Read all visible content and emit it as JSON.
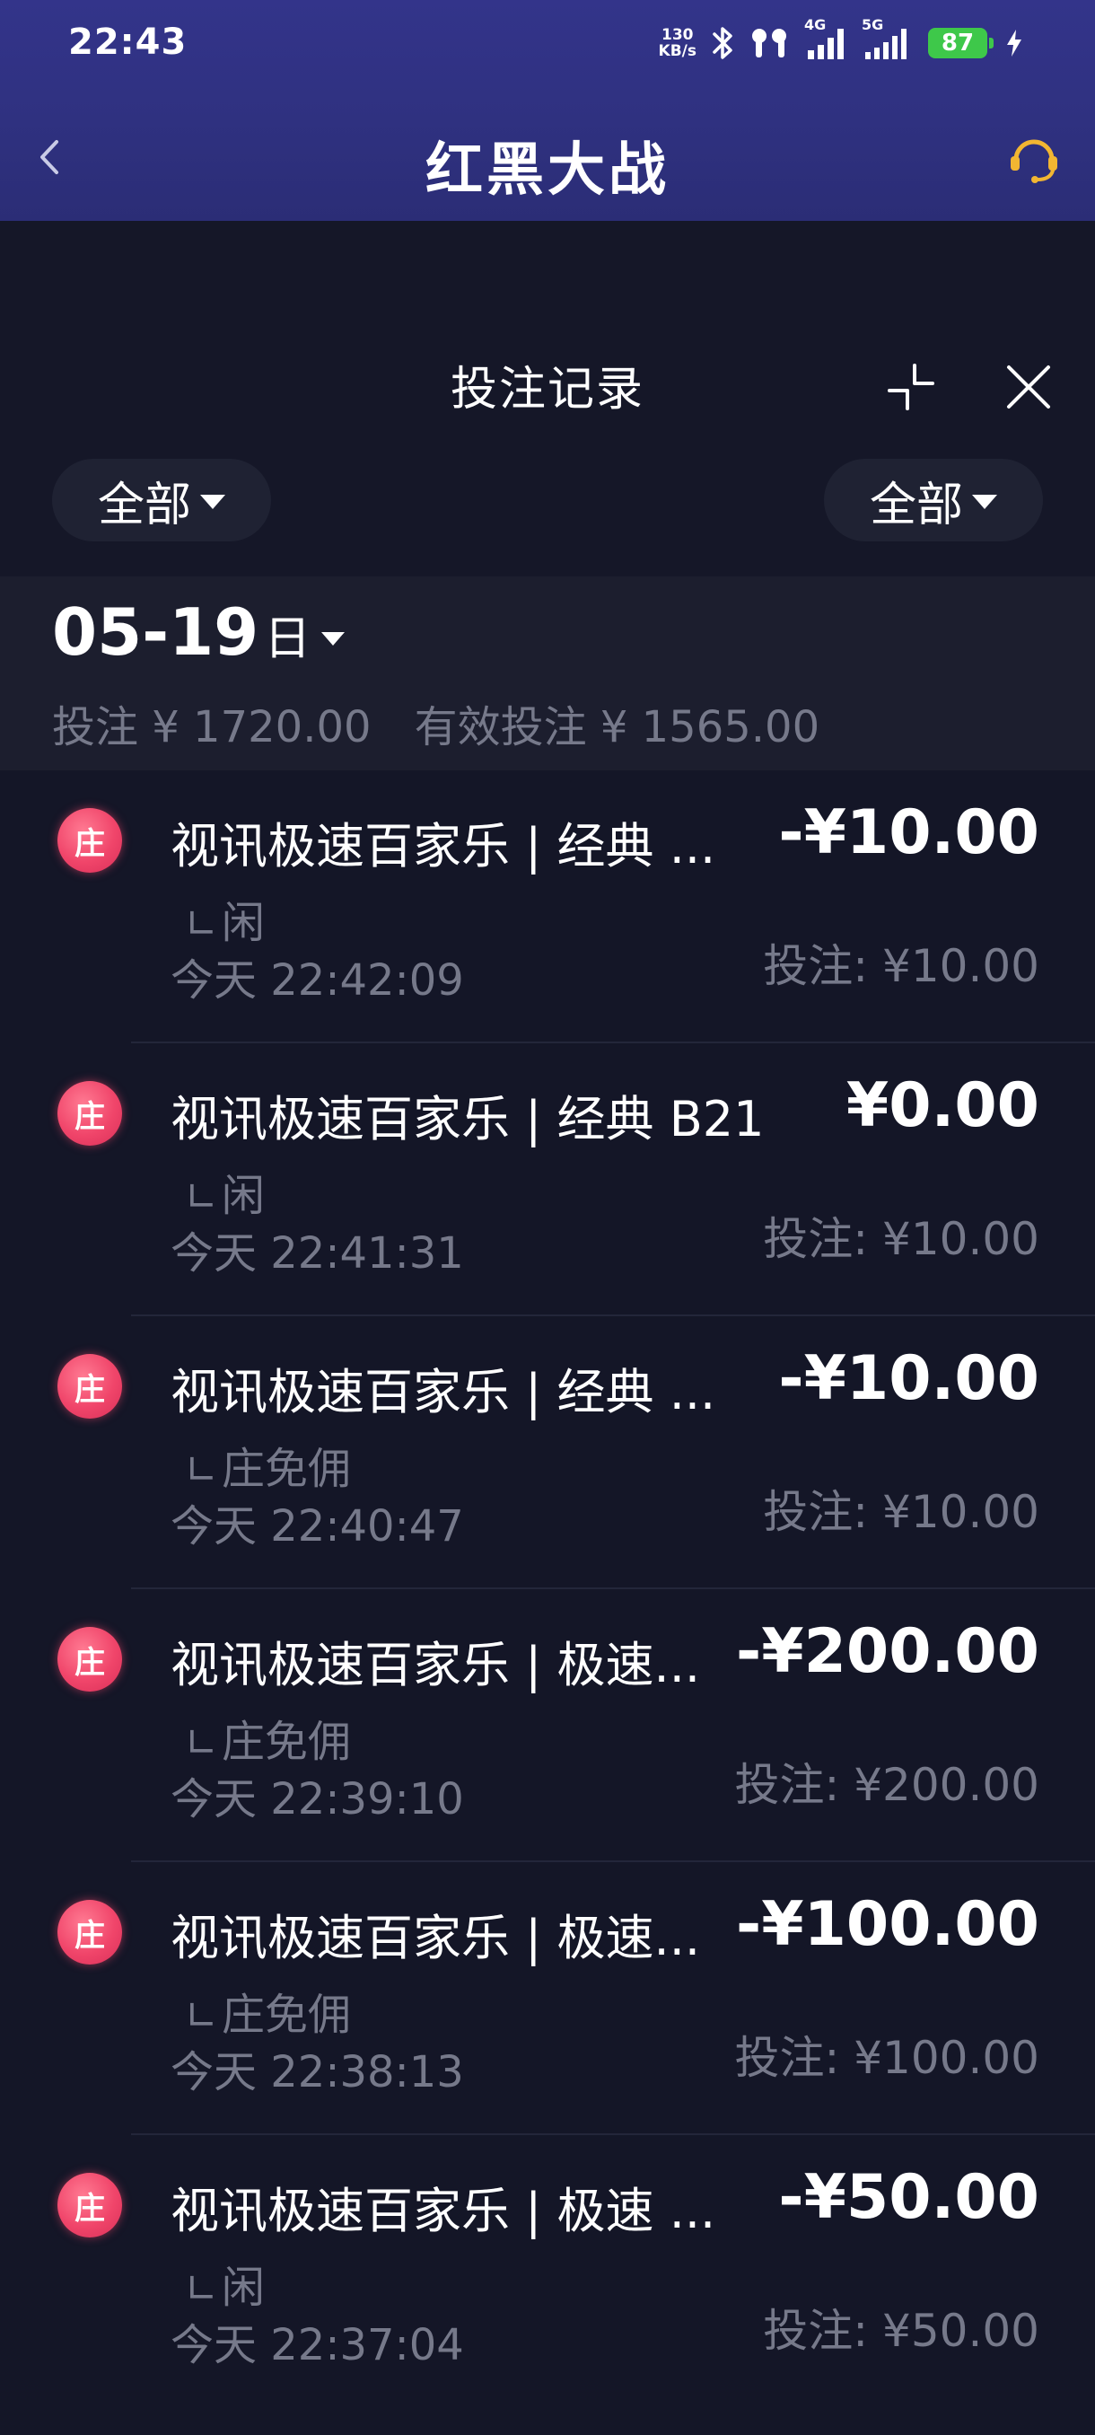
{
  "status_bar": {
    "time": "22:43",
    "net_speed_value": "130",
    "net_speed_unit": "KB/s",
    "mobile_1": "4G",
    "mobile_2": "5G",
    "battery": "87"
  },
  "nav": {
    "title": "红黑大战"
  },
  "panel": {
    "title": "投注记录",
    "filter_left": "全部",
    "filter_right": "全部"
  },
  "summary": {
    "date": "05-19",
    "weekday": "日",
    "bet_total": "投注 ¥ 1720.00",
    "valid_bet_total": "有效投注 ¥ 1565.00"
  },
  "records": [
    {
      "badge": "庄",
      "game": "视讯极速百家乐 | 经典 ...",
      "amount": "-¥10.00",
      "type": "闲",
      "time": "今天 22:42:09",
      "stake": "投注: ¥10.00"
    },
    {
      "badge": "庄",
      "game": "视讯极速百家乐 | 经典 B21",
      "amount": "¥0.00",
      "type": "闲",
      "time": "今天 22:41:31",
      "stake": "投注: ¥10.00"
    },
    {
      "badge": "庄",
      "game": "视讯极速百家乐 | 经典 ...",
      "amount": "-¥10.00",
      "type": "庄免佣",
      "time": "今天 22:40:47",
      "stake": "投注: ¥10.00"
    },
    {
      "badge": "庄",
      "game": "视讯极速百家乐 | 极速...",
      "amount": "-¥200.00",
      "type": "庄免佣",
      "time": "今天 22:39:10",
      "stake": "投注: ¥200.00"
    },
    {
      "badge": "庄",
      "game": "视讯极速百家乐 | 极速...",
      "amount": "-¥100.00",
      "type": "庄免佣",
      "time": "今天 22:38:13",
      "stake": "投注: ¥100.00"
    },
    {
      "badge": "庄",
      "game": "视讯极速百家乐 | 极速 ...",
      "amount": "-¥50.00",
      "type": "闲",
      "time": "今天 22:37:04",
      "stake": "投注: ¥50.00"
    }
  ],
  "icons": {
    "back": "chevron-left-icon",
    "support": "headset-icon",
    "collapse": "collapse-icon",
    "close": "close-icon",
    "bluetooth": "bluetooth-icon",
    "earbuds": "earbuds-icon",
    "charging": "bolt-icon"
  },
  "colors": {
    "header_bg": "#2f3180",
    "page_bg": "#141627",
    "badge": "#f0456a",
    "muted_text": "#76798a",
    "battery": "#3ec84a",
    "support_icon": "#f2b632"
  }
}
